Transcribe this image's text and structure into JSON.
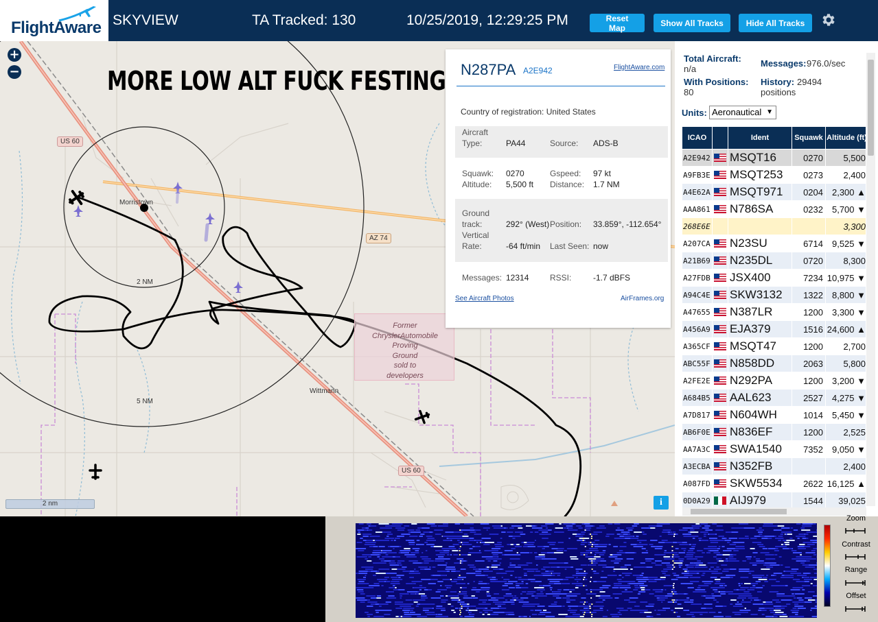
{
  "header": {
    "logo": "FlightAware",
    "site_name": "SKYVIEW",
    "ta_tracked": "TA Tracked: 130",
    "datetime": "10/25/2019, 12:29:25 PM",
    "buttons": {
      "reset_map": "Reset Map",
      "show_all": "Show All Tracks",
      "hide_all": "Hide All Tracks"
    },
    "settings_icon": "gear-icon"
  },
  "map": {
    "caption": "MORE LOW ALT FUCK FESTING",
    "zoom_in": "+",
    "zoom_out": "−",
    "scale": "2 nm",
    "info": "i",
    "labels": {
      "morristown": "Morristown",
      "wittmann": "Wittmann",
      "ring_2": "2 NM",
      "ring_5": "5 NM",
      "us60_a": "US 60",
      "us60_b": "US 60",
      "az74": "AZ 74",
      "proving_ground": [
        "Former",
        "ChryslerAutomobile",
        "Proving",
        "Ground",
        "sold to",
        "developers"
      ]
    },
    "colors": {
      "land": "#ece9e3",
      "highway": "#e8917f",
      "state_route": "#f3b76a",
      "water": "#a5c8de",
      "boundary": "#c98bd6",
      "track": "#000000"
    }
  },
  "popup": {
    "ident": "N287PA",
    "hex": "A2E942",
    "fa_link": "FlightAware.com",
    "country_label": "Country of registration:",
    "country": "United States",
    "aircraft_type_label_1": "Aircraft",
    "aircraft_type_label_2": "Type:",
    "aircraft_type": "PA44",
    "source_label": "Source:",
    "source": "ADS-B",
    "squawk_label": "Squawk:",
    "squawk": "0270",
    "gspeed_label": "Gspeed:",
    "gspeed": "97 kt",
    "altitude_label": "Altitude:",
    "altitude": "5,500 ft",
    "distance_label": "Distance:",
    "distance": "1.7 NM",
    "ground_label_1": "Ground",
    "ground_label_2": "track:",
    "ground_track": "292° (West)",
    "position_label": "Position:",
    "position": "33.859°, -112.654°",
    "vrate_label_1": "Vertical",
    "vrate_label_2": "Rate:",
    "vertical_rate": "-64 ft/min",
    "last_seen_label": "Last Seen:",
    "last_seen": "now",
    "messages_label": "Messages:",
    "messages": "12314",
    "rssi_label": "RSSI:",
    "rssi": "-1.7 dBFS",
    "photos_link": "See Aircraft Photos",
    "airframes_link": "AirFrames.org"
  },
  "sidebar": {
    "total_aircraft_label": "Total Aircraft:",
    "total_aircraft": "n/a",
    "messages_label": "Messages:",
    "messages": "976.0/sec",
    "with_positions_label": "With Positions:",
    "with_positions": "80",
    "history_label": "History:",
    "history": "29494",
    "history_unit": "positions",
    "units_label": "Units:",
    "units_value": "Aeronautical",
    "columns": [
      "ICAO",
      "",
      "Ident",
      "Squawk",
      "Altitude (ft)"
    ],
    "rows": [
      {
        "icao": "A2E942",
        "flag": "us",
        "ident": "MSQT16",
        "squawk": "0270",
        "alt": "5,500",
        "state": "sel"
      },
      {
        "icao": "A9FB3E",
        "flag": "us",
        "ident": "MSQT253",
        "squawk": "0273",
        "alt": "2,400",
        "state": ""
      },
      {
        "icao": "A4E62A",
        "flag": "us",
        "ident": "MSQT971",
        "squawk": "0204",
        "alt": "2,300 ▲",
        "state": "alt"
      },
      {
        "icao": "AAA861",
        "flag": "us",
        "ident": "N786SA",
        "squawk": "0232",
        "alt": "5,700 ▼",
        "state": ""
      },
      {
        "icao": "268E6E",
        "flag": "",
        "ident": "",
        "squawk": "",
        "alt": "3,300",
        "state": "noshow"
      },
      {
        "icao": "A207CA",
        "flag": "us",
        "ident": "N23SU",
        "squawk": "6714",
        "alt": "9,525 ▼",
        "state": ""
      },
      {
        "icao": "A21B69",
        "flag": "us",
        "ident": "N235DL",
        "squawk": "0720",
        "alt": "8,300",
        "state": "alt"
      },
      {
        "icao": "A27FDB",
        "flag": "us",
        "ident": "JSX400",
        "squawk": "7234",
        "alt": "10,975 ▼",
        "state": ""
      },
      {
        "icao": "A94C4E",
        "flag": "us",
        "ident": "SKW3132",
        "squawk": "1322",
        "alt": "8,800 ▼",
        "state": "alt"
      },
      {
        "icao": "A47655",
        "flag": "us",
        "ident": "N387LR",
        "squawk": "1200",
        "alt": "3,300 ▼",
        "state": ""
      },
      {
        "icao": "A456A9",
        "flag": "us",
        "ident": "EJA379",
        "squawk": "1516",
        "alt": "24,600 ▲",
        "state": "alt"
      },
      {
        "icao": "A365CF",
        "flag": "us",
        "ident": "MSQT47",
        "squawk": "1200",
        "alt": "2,700",
        "state": ""
      },
      {
        "icao": "ABC55F",
        "flag": "us",
        "ident": "N858DD",
        "squawk": "2063",
        "alt": "5,800",
        "state": "alt"
      },
      {
        "icao": "A2FE2E",
        "flag": "us",
        "ident": "N292PA",
        "squawk": "1200",
        "alt": "3,200 ▼",
        "state": ""
      },
      {
        "icao": "A684B5",
        "flag": "us",
        "ident": "AAL623",
        "squawk": "2527",
        "alt": "4,275 ▼",
        "state": "alt"
      },
      {
        "icao": "A7D817",
        "flag": "us",
        "ident": "N604WH",
        "squawk": "1014",
        "alt": "5,450 ▼",
        "state": ""
      },
      {
        "icao": "AB6F0E",
        "flag": "us",
        "ident": "N836EF",
        "squawk": "1200",
        "alt": "2,525",
        "state": "alt"
      },
      {
        "icao": "AA7A3C",
        "flag": "us",
        "ident": "SWA1540",
        "squawk": "7352",
        "alt": "9,050 ▼",
        "state": ""
      },
      {
        "icao": "A3ECBA",
        "flag": "us",
        "ident": "N352FB",
        "squawk": "",
        "alt": "2,400",
        "state": "alt"
      },
      {
        "icao": "A087FD",
        "flag": "us",
        "ident": "SKW5534",
        "squawk": "2622",
        "alt": "16,125 ▲",
        "state": ""
      },
      {
        "icao": "0D0A29",
        "flag": "mx",
        "ident": "AIJ979",
        "squawk": "1544",
        "alt": "39,025",
        "state": "alt"
      }
    ]
  },
  "waterfall": {
    "zoom_label": "Zoom",
    "contrast_label": "Contrast",
    "range_label": "Range",
    "offset_label": "Offset"
  }
}
